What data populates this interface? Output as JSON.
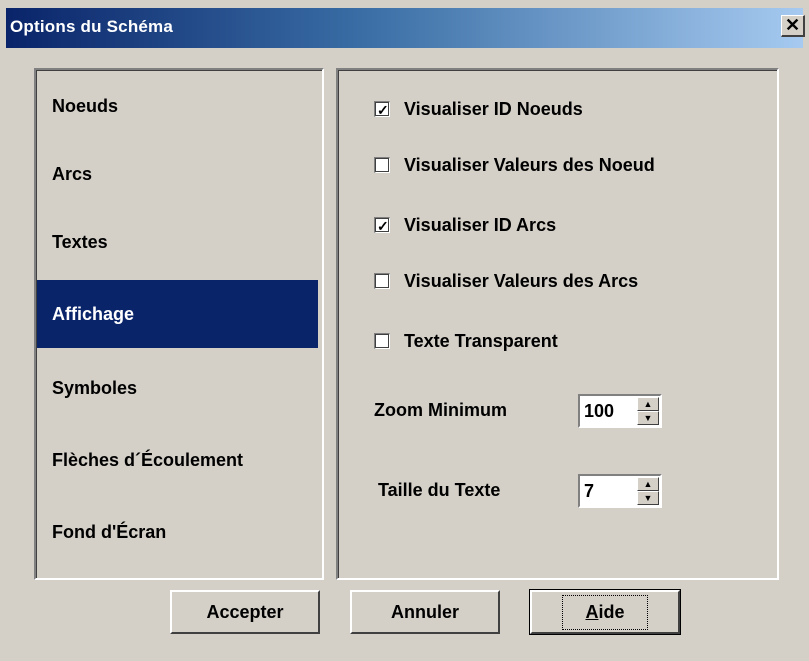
{
  "dialog": {
    "title": "Options du Schéma",
    "close_glyph": "✕"
  },
  "nav": {
    "items": [
      {
        "label": "Noeuds",
        "selected": false
      },
      {
        "label": "Arcs",
        "selected": false
      },
      {
        "label": "Textes",
        "selected": false
      },
      {
        "label": "Affichage",
        "selected": true
      },
      {
        "label": "Symboles",
        "selected": false
      },
      {
        "label": "Flèches d´Écoulement",
        "selected": false
      },
      {
        "label": "Fond  d'Écran",
        "selected": false
      }
    ]
  },
  "display": {
    "checkboxes": [
      {
        "label": "Visualiser ID Noeuds",
        "checked": true
      },
      {
        "label": "Visualiser Valeurs des Noeud",
        "checked": false
      },
      {
        "label": "Visualiser ID Arcs",
        "checked": true
      },
      {
        "label": "Visualiser Valeurs des Arcs",
        "checked": false
      },
      {
        "label": "Texte Transparent",
        "checked": false
      }
    ],
    "zoom_label": "Zoom Minimum",
    "zoom_value": "100",
    "text_size_label": "Taille du Texte",
    "text_size_value": "7",
    "check_glyph": "✓",
    "spin_up_glyph": "▲",
    "spin_down_glyph": "▼"
  },
  "buttons": {
    "accept": "Accepter",
    "cancel": "Annuler",
    "help": "Aide"
  },
  "colors": {
    "face": "#d4d0c8",
    "selection": "#0a246a",
    "title_gradient_start": "#0a246a",
    "title_gradient_end": "#a6caf0"
  }
}
